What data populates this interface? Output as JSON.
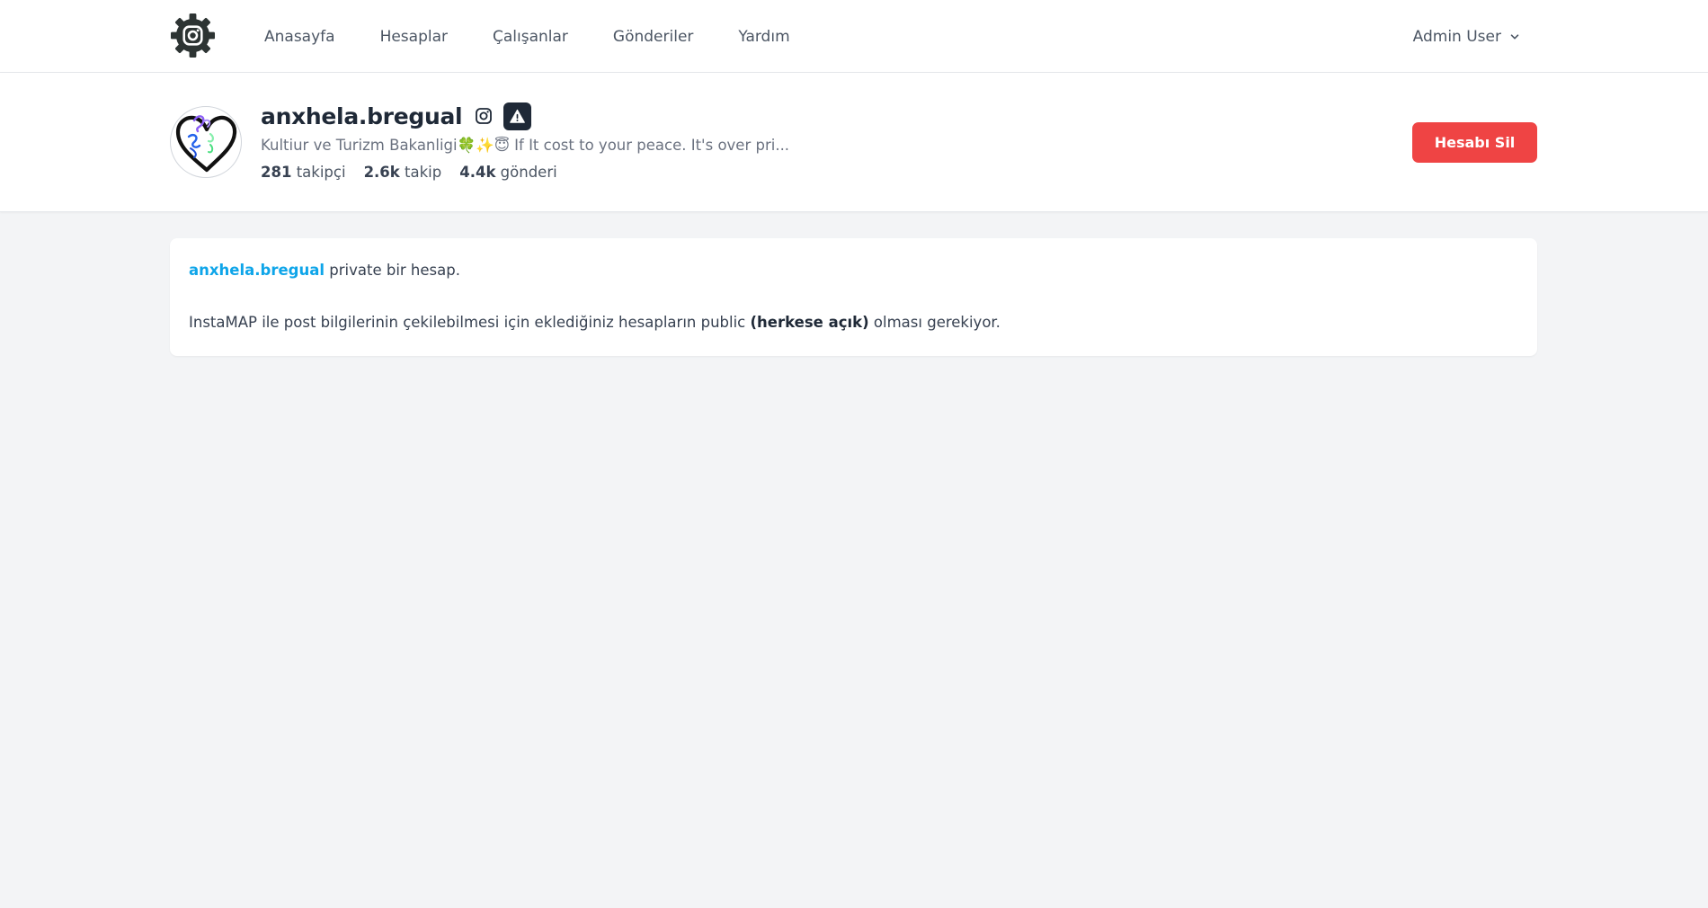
{
  "navbar": {
    "logo_icon": "instagram-gear-logo-icon",
    "links": [
      "Anasayfa",
      "Hesaplar",
      "Çalışanlar",
      "Gönderiler",
      "Yardım"
    ],
    "user_menu": {
      "label": "Admin User",
      "icon": "chevron-down-icon"
    }
  },
  "profile": {
    "username": "anxhela.bregual",
    "bio": "Kultiur ve Turizm Bakanligi🍀✨😇 If It cost to your peace. It's over pri...",
    "stats": {
      "followers_value": "281",
      "followers_label": "takipçi",
      "following_value": "2.6k",
      "following_label": "takip",
      "posts_value": "4.4k",
      "posts_label": "gönderi"
    },
    "icons": [
      "instagram-icon",
      "warning-icon"
    ],
    "delete_button": "Hesabı Sil"
  },
  "notice": {
    "account_link": "anxhela.bregual",
    "line1_rest": " private bir hesap.",
    "line2_pre": "InstaMAP ile post bilgilerinin çekilebilmesi için eklediğiniz hesapların public ",
    "line2_bold": "(herkese açık)",
    "line2_post": " olması gerekiyor."
  },
  "colors": {
    "accent_link": "#0ea5e9",
    "danger_button": "#ef4444",
    "page_background": "#f3f4f6",
    "badge_dark": "#1f2937"
  }
}
